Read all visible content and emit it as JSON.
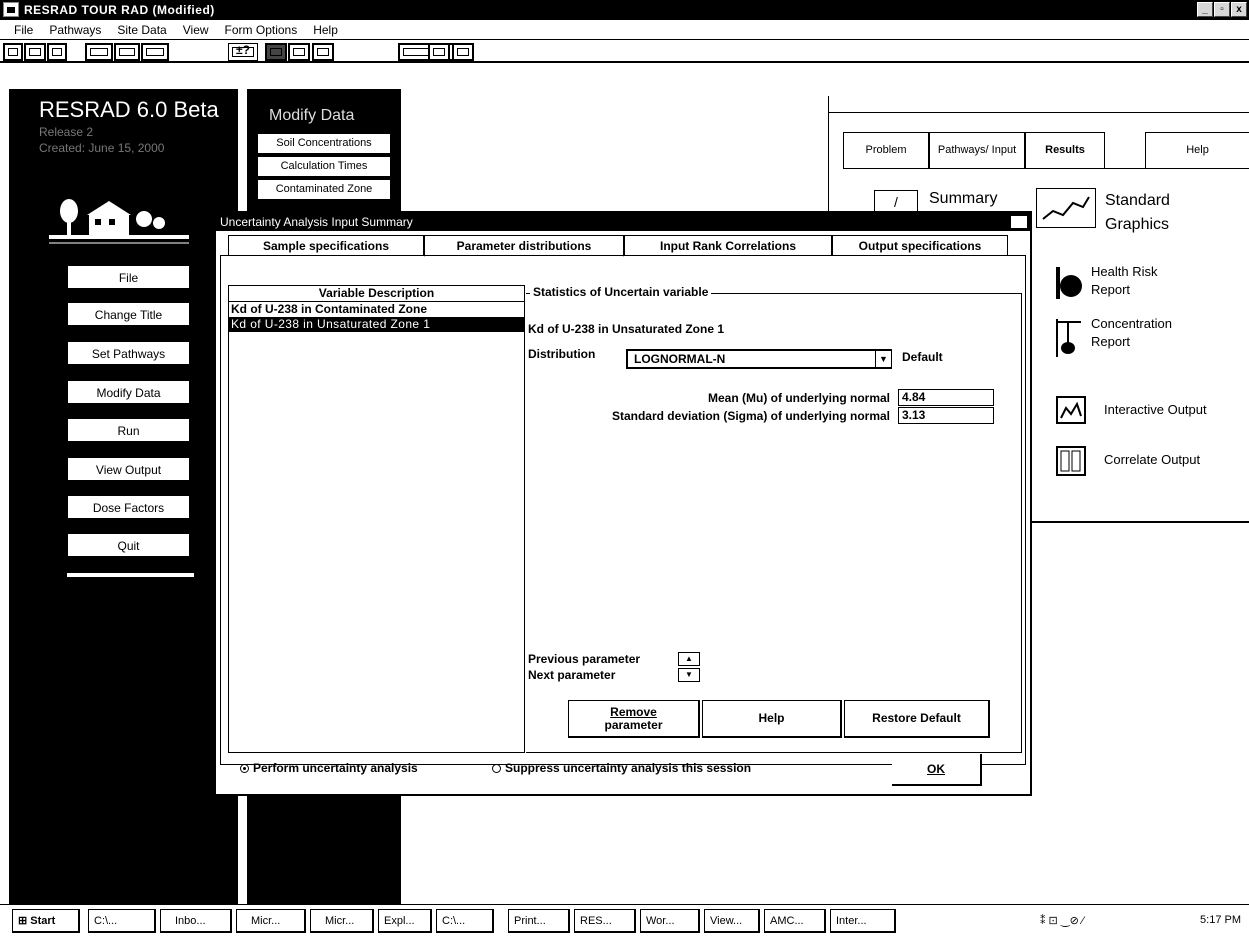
{
  "window": {
    "title": "RESRAD   TOUR RAD  (Modified)",
    "buttons": [
      "_",
      "▫",
      "x"
    ]
  },
  "menu": [
    "File",
    "Pathways",
    "Site Data",
    "View",
    "Form Options",
    "Help"
  ],
  "toolbar": {
    "plusminus": "±?"
  },
  "left_panel": {
    "brand": "RESRAD 6.0 Beta",
    "release": "Release 2",
    "created": "Created: June 15, 2000",
    "buttons": [
      "File",
      "Change Title",
      "Set Pathways",
      "Modify Data",
      "Run",
      "View Output",
      "Dose Factors",
      "Quit"
    ]
  },
  "modify_panel": {
    "title": "Modify Data",
    "buttons": [
      "Soil Concentrations",
      "Calculation Times",
      "Contaminated Zone"
    ]
  },
  "results_panel": {
    "tabs": [
      "Problem",
      "Pathways/ Input",
      "Results",
      "Help"
    ],
    "summary": "Summary",
    "standard_graphics": [
      "Standard",
      "Graphics"
    ],
    "health_risk": [
      "Health Risk",
      "Report"
    ],
    "concentration": [
      "Concentration",
      "Report"
    ],
    "interactive": "Interactive Output",
    "correlate": "Correlate Output"
  },
  "dialog": {
    "title": "Uncertainty Analysis Input Summary",
    "tabs": [
      "Sample specifications",
      "Parameter distributions",
      "Input Rank Correlations",
      "Output specifications"
    ],
    "variable_header": "Variable Description",
    "variables": [
      "Kd of U-238 in Contaminated Zone",
      "Kd of U-238 in Unsaturated Zone 1"
    ],
    "stats_legend": "Statistics of Uncertain variable",
    "selected_variable": "Kd of U-238 in Unsaturated Zone 1",
    "distribution_label": "Distribution",
    "distribution_value": "LOGNORMAL-N",
    "default_label": "Default",
    "mean_label": "Mean (Mu) of underlying normal",
    "mean_value": "4.84",
    "sd_label": "Standard deviation (Sigma) of underlying normal",
    "sd_value": "3.13",
    "previous_parameter": "Previous parameter",
    "next_parameter": "Next parameter",
    "remove_button": [
      "Remove",
      "parameter"
    ],
    "help_button": "Help",
    "restore_button": "Restore Default",
    "perform_radio": "Perform uncertainty analysis",
    "suppress_radio": "Suppress uncertainty analysis this session",
    "ok_button": "OK"
  },
  "taskbar": {
    "start": "Start",
    "tasks": [
      "C:\\...",
      "Inbo...",
      "Micr...",
      "Micr...",
      "Expl...",
      "C:\\...",
      "Print...",
      "RES...",
      "Wor...",
      "View...",
      "AMC...",
      "Inter..."
    ],
    "clock": "5:17 PM"
  }
}
